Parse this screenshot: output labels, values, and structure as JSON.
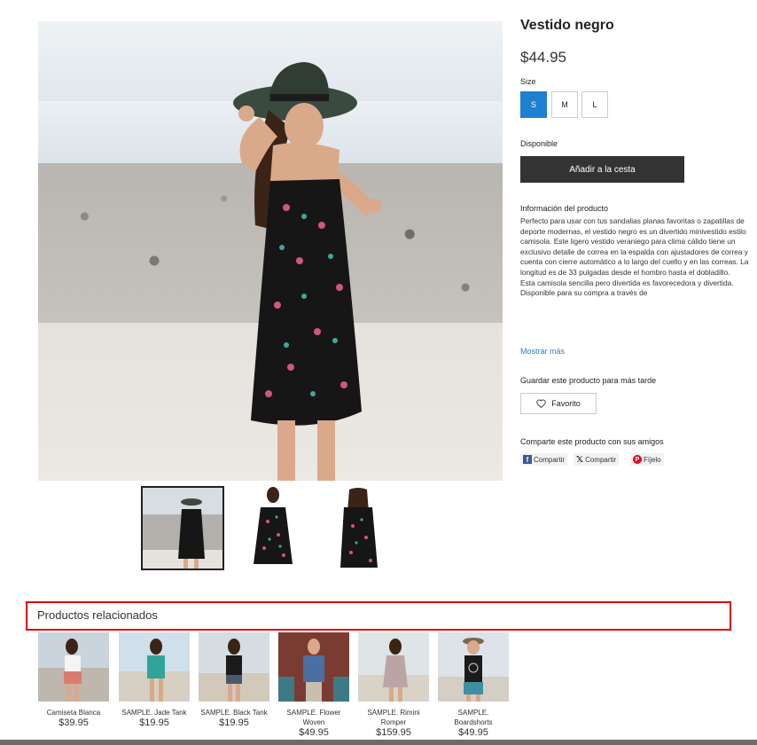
{
  "product": {
    "title": "Vestido negro",
    "price": "$44.95",
    "size_label": "Size",
    "sizes": [
      "S",
      "M",
      "L"
    ],
    "selected_size": "S",
    "availability": "Disponible",
    "add_to_cart": "Añadir a la cesta",
    "info_heading": "Información del producto",
    "info_text": "Perfecto para usar con tus sandalias planas favoritas o zapatillas de deporte modernas, el vestido negro es un divertido minivestido estilo camisola. Este ligero vestido veraniego para clima cálido tiene un exclusivo detalle de correa en la espalda con ajustadores de correa y cuenta con cierre automático a lo largo del cuello y en las correas. La longitud es de 33 pulgadas desde el hombro hasta el dobladillo.\nEsta camisola sencilla pero divertida es favorecedora y divertida. Disponible para su compra a través de",
    "more_link": "Mostrar más",
    "save_heading": "Guardar este producto para más tarde",
    "favorite_label": "Favorito",
    "share_heading": "Comparte este producto con sus amigos",
    "share": {
      "facebook": "Compartir",
      "x": "Compartir",
      "pinterest": "Fíjelo"
    }
  },
  "related": {
    "title": "Productos relacionados",
    "items": [
      {
        "name": "Camiseta Blanca",
        "price": "$39.95"
      },
      {
        "name": "SAMPLE. Jade Tank",
        "price": "$19.95"
      },
      {
        "name": "SAMPLE. Black Tank",
        "price": "$19.95"
      },
      {
        "name": "SAMPLE. Flower Woven",
        "price": "$49.95"
      },
      {
        "name": "SAMPLE. Rimini Romper",
        "price": "$159.95"
      },
      {
        "name": "SAMPLE. Boardshorts",
        "price": "$49.95"
      }
    ]
  },
  "colors": {
    "accent": "#1f7fd0",
    "cart_button": "#333333",
    "highlight_border": "#e00000"
  },
  "icons": [
    "heart-icon",
    "facebook-icon",
    "x-icon",
    "pinterest-icon"
  ]
}
